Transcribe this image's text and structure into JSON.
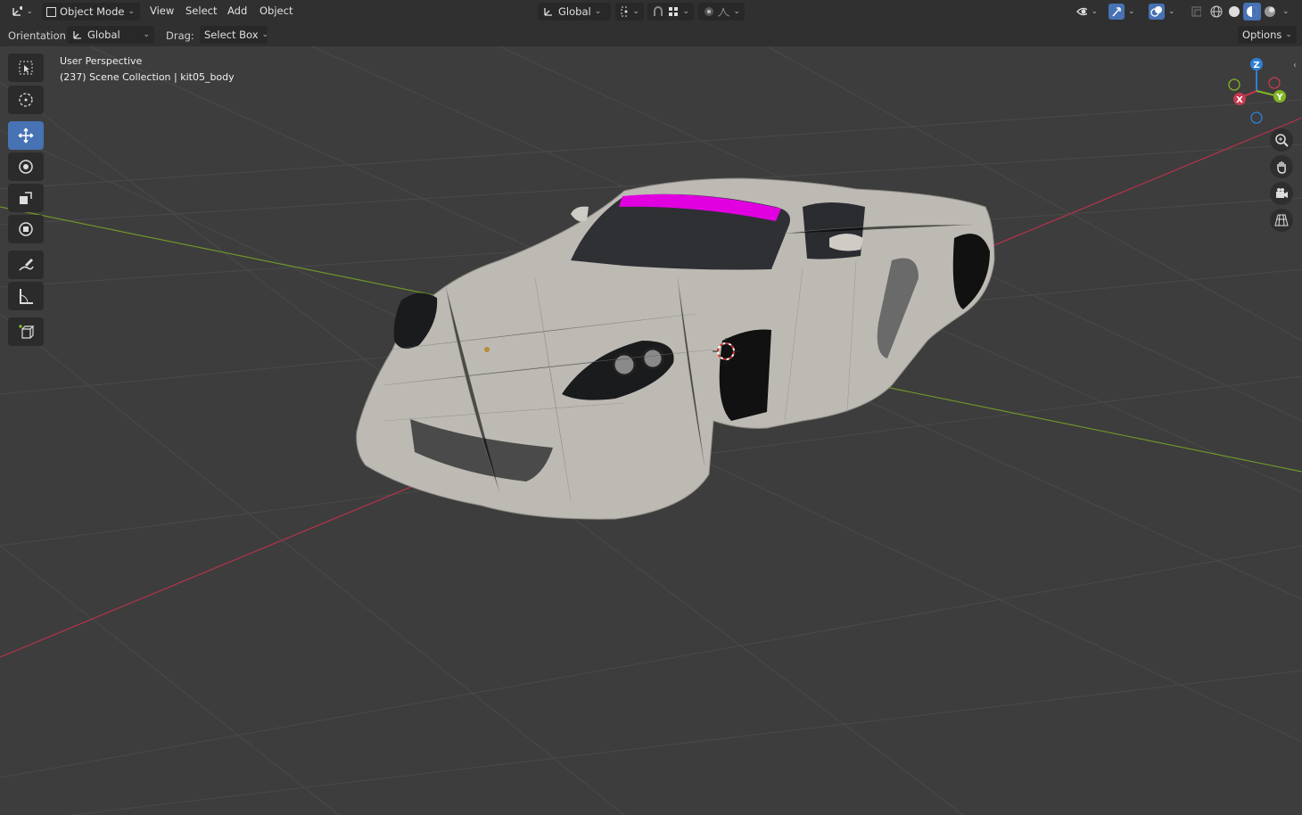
{
  "header": {
    "mode": "Object Mode",
    "menus": [
      "View",
      "Select",
      "Add",
      "Object"
    ],
    "transform_orientation": "Global",
    "editor_icon": "editor-type-icon",
    "snap_icon": "snap-icon",
    "proportional_icon": "proportional-edit-icon"
  },
  "tool_settings": {
    "orientation_label": "Orientation:",
    "orientation_value": "Global",
    "drag_label": "Drag:",
    "drag_value": "Select Box",
    "options_label": "Options"
  },
  "viewport": {
    "view_name": "User Perspective",
    "scene_info": "(237) Scene Collection | kit05_body"
  },
  "gizmo": {
    "z": "Z",
    "y": "Y",
    "x": "X"
  },
  "toolbar": {
    "tools": [
      "select-box",
      "cursor",
      "move",
      "rotate",
      "scale",
      "transform",
      "annotate",
      "measure",
      "add-cube"
    ],
    "active": "move"
  },
  "colors": {
    "accent": "#4772b3",
    "x_axis": "#c8394f",
    "y_axis": "#83b626",
    "z_axis": "#2f7fd6",
    "selection": "#e000e0"
  }
}
